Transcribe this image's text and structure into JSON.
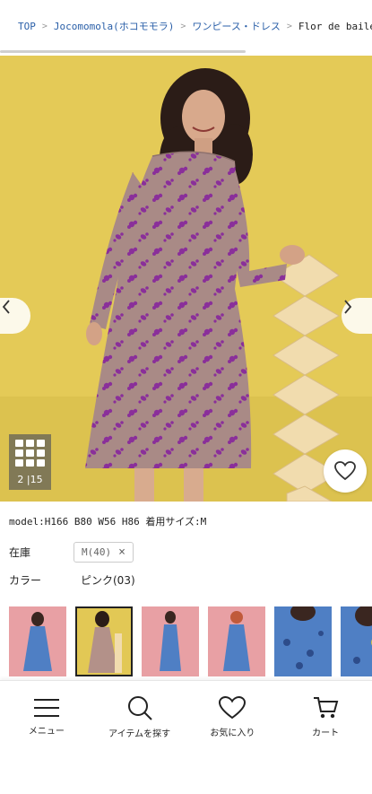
{
  "breadcrumb": {
    "items": [
      "TOP",
      "Jocomomola(ホコモモラ)",
      "ワンピース・ドレス",
      "Flor de baile フ"
    ]
  },
  "gallery": {
    "counter": "2 |15",
    "prev_icon": "chevron-left-icon",
    "next_icon": "chevron-right-icon",
    "favorite_icon": "heart-outline-icon",
    "colors": {
      "background": "#e3c955",
      "dress": "#a98a86",
      "print": "#8a2f9a"
    }
  },
  "product": {
    "model_info": "model:H166 B80 W56 H86 着用サイズ:M",
    "stock_label": "在庫",
    "stock_value": "M(40)",
    "color_label": "カラー",
    "color_value": "ピンク(03)"
  },
  "thumbnails": [
    {
      "name": "blue-dress-front",
      "selected": false
    },
    {
      "name": "pink-dress-front",
      "selected": true
    },
    {
      "name": "blue-dress-side",
      "selected": false
    },
    {
      "name": "blue-dress-back",
      "selected": false
    },
    {
      "name": "blue-dress-detail",
      "selected": false
    },
    {
      "name": "blue-dress-closeup",
      "selected": false
    }
  ],
  "bottom_nav": {
    "menu": "メニュー",
    "search": "アイテムを探す",
    "favorites": "お気に入り",
    "cart": "カート"
  }
}
